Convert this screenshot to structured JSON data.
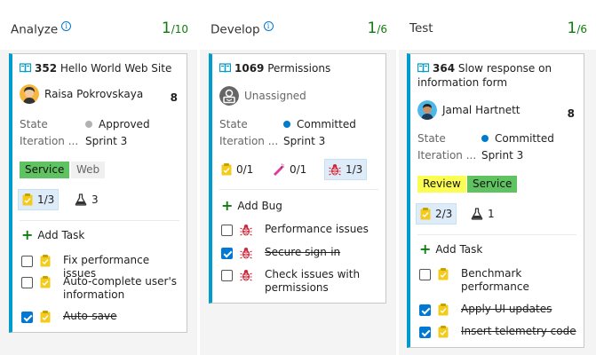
{
  "columns": [
    {
      "title": "Analyze",
      "count": "1",
      "limit": "/10",
      "card": {
        "id": "352",
        "title": "Hello World Web Site",
        "assignee": "Raisa Pokrovskaya",
        "effort": "8",
        "state_label": "State",
        "state": "Approved",
        "state_color": "#b2b2b2",
        "iteration_label": "Iteration ...",
        "iteration": "Sprint 3",
        "tags": [
          "Service",
          "Web"
        ],
        "rollup_tasks": "1/3",
        "rollup_tests": "3",
        "add_label": "Add Task",
        "children": [
          {
            "text": "Fix performance issues",
            "done": false
          },
          {
            "text": "Auto-complete user's information",
            "done": false
          },
          {
            "text": "Auto-save",
            "done": true
          }
        ]
      }
    },
    {
      "title": "Develop",
      "count": "1",
      "limit": "/6",
      "card": {
        "id": "1069",
        "title": "Permissions",
        "assignee": "Unassigned",
        "state_label": "State",
        "state": "Committed",
        "state_color": "#007acc",
        "iteration_label": "Iteration ...",
        "iteration": "Sprint 3",
        "rollup_tasks": "0/1",
        "rollup_features": "0/1",
        "rollup_bugs": "1/3",
        "add_label": "Add Bug",
        "children": [
          {
            "text": "Performance issues",
            "done": false
          },
          {
            "text": "Secure sign-in",
            "done": true
          },
          {
            "text": "Check issues with permissions",
            "done": false
          }
        ]
      }
    },
    {
      "title": "Test",
      "count": "1",
      "limit": "/6",
      "card": {
        "id": "364",
        "title": "Slow response on information form",
        "assignee": "Jamal Hartnett",
        "effort": "8",
        "state_label": "State",
        "state": "Committed",
        "state_color": "#007acc",
        "iteration_label": "Iteration ...",
        "iteration": "Sprint 3",
        "tags": [
          "Review",
          "Service"
        ],
        "rollup_tasks": "2/3",
        "rollup_tests": "1",
        "add_label": "Add Task",
        "children": [
          {
            "text": "Benchmark performance",
            "done": false
          },
          {
            "text": "Apply UI updates",
            "done": true
          },
          {
            "text": "Insert telemetry code",
            "done": true
          }
        ]
      }
    }
  ]
}
